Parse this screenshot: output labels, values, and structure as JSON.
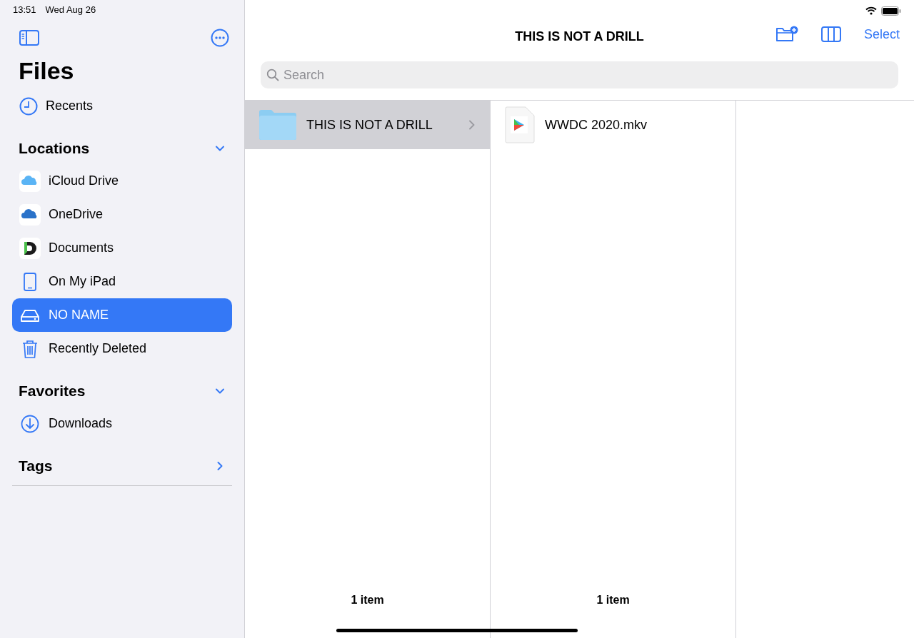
{
  "status_bar": {
    "time": "13:51",
    "date": "Wed Aug 26"
  },
  "sidebar": {
    "title": "Files",
    "recents": {
      "label": "Recents",
      "selected": false
    },
    "sections": [
      {
        "title": "Locations",
        "expanded": true,
        "items": [
          {
            "label": "iCloud Drive",
            "selected": false
          },
          {
            "label": "OneDrive",
            "selected": false
          },
          {
            "label": "Documents",
            "selected": false
          },
          {
            "label": "On My iPad",
            "selected": false
          },
          {
            "label": "NO NAME",
            "selected": true
          },
          {
            "label": "Recently Deleted",
            "selected": false
          }
        ]
      },
      {
        "title": "Favorites",
        "expanded": true,
        "items": [
          {
            "label": "Downloads",
            "selected": false
          }
        ]
      },
      {
        "title": "Tags",
        "expanded": false
      }
    ]
  },
  "toolbar": {
    "title": "THIS IS NOT A DRILL",
    "search": {
      "placeholder": "Search"
    },
    "select": "Select"
  },
  "columns": [
    {
      "items": [
        {
          "label": "THIS IS NOT A DRILL",
          "kind": "folder",
          "selected": true
        }
      ],
      "footer": "1 item"
    },
    {
      "items": [
        {
          "label": "WWDC 2020.mkv",
          "kind": "file",
          "selected": false
        }
      ],
      "footer": "1 item"
    }
  ]
}
